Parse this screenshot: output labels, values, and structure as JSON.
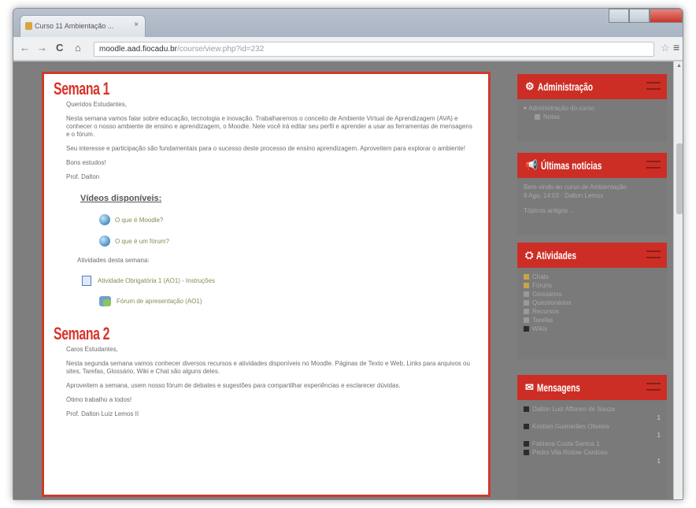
{
  "browser": {
    "tab_title": "Curso 11 Ambientação ...",
    "tab_close": "×",
    "url_host": "moodle.aad.fiocadu.br",
    "url_rest": "/course/view.php?id=232",
    "back": "←",
    "forward": "→",
    "reload": "C",
    "home": "⌂",
    "bookmark_star": "☆",
    "menu": "≡"
  },
  "main": {
    "week1": {
      "title": "Semana 1",
      "greeting": "Queridos Estudantes,",
      "p1": "Nesta semana vamos falar sobre educação, tecnologia e inovação. Trabalharemos o conceito de Ambiente Virtual de Aprendizagem (AVA) e conhecer o nosso ambiente de ensino e aprendizagem, o Moodle. Nele você irá editar seu perfil e aprender a usar as ferramentas de mensagens e o fórum.",
      "p2": "Seu interesse e participação são fundamentais para o sucesso deste processo de ensino aprendizagem. Aproveitem para explorar o ambiente!",
      "p3": "Bons estudos!",
      "signature": "Prof. Dalton",
      "videos_heading": "Vídeos disponíveis:",
      "video1": "O que é Moodle?",
      "video2": "O que é um fórum?",
      "activities_label": "Atividades desta semana:",
      "activity1": "Atividade Obrigatória 1 (AO1) - Instruções",
      "activity2": "Fórum de apresentação (AO1)"
    },
    "week2": {
      "title": "Semana 2",
      "greeting": "Caros Estudantes,",
      "p1": "Nesta segunda semana vamos conhecer diversos recursos e atividades disponíveis no Moodle. Páginas de Texto e Web, Links para arquivos ou sites, Tarefas, Glossário, Wiki e Chat são alguns deles.",
      "p2": "Aproveitem a semana, usem nosso fórum de debates e sugestões para compartilhar experiências e esclarecer dúvidas.",
      "p3": "Ótimo trabalho a todos!",
      "signature": "Prof. Dalton Luiz Lemos II"
    }
  },
  "sidebar": {
    "admin": {
      "title": "Administração",
      "item1": "Administração do curso",
      "item2": "Notas"
    },
    "news": {
      "title": "Últimas notícias",
      "item1": "Bem-vindo ao curso de Ambientação",
      "item2": "8 Ago, 14:03 · Dalton Lemos",
      "item3": "Tópicos antigos ..."
    },
    "activities": {
      "title": "Atividades",
      "items": [
        "Chats",
        "Fóruns",
        "Glossários",
        "Questionários",
        "Recursos",
        "Tarefas",
        "Wikis"
      ]
    },
    "messages": {
      "title": "Mensagens",
      "m1": "Dalton Luiz Affonso de Souza",
      "m1_count": "1",
      "m2": "Kristian Guimarães Oliveira",
      "m2_count": "1",
      "m3": "Fabiana Costa Santos",
      "m3_count": "1",
      "m4": "Pedro Vila Ristow Cardoso",
      "m4_count": "1"
    }
  },
  "colors": {
    "accent": "#cc2e25",
    "title_red": "#d8332a",
    "panel_border": "#cc3b2e"
  }
}
